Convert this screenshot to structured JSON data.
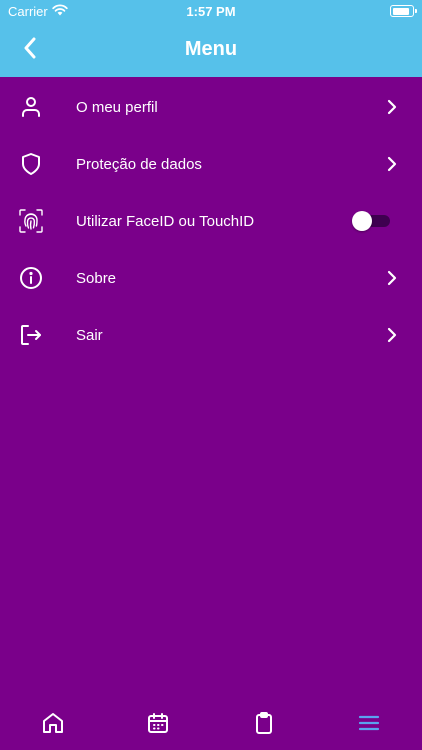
{
  "status_bar": {
    "carrier": "Carrier",
    "time": "1:57 PM"
  },
  "nav": {
    "title": "Menu",
    "back_icon": "chevron-left-icon"
  },
  "colors": {
    "header_bg": "#56c1ea",
    "page_bg": "#7a008a",
    "active_tab": "#5aa2f0",
    "text": "#ffffff"
  },
  "menu": {
    "items": [
      {
        "label": "O meu perfil",
        "icon": "user-icon",
        "control": "chevron"
      },
      {
        "label": "Proteção de dados",
        "icon": "shield-icon",
        "control": "chevron"
      },
      {
        "label": "Utilizar FaceID ou TouchID",
        "icon": "fingerprint-icon",
        "control": "toggle",
        "toggle_on": false
      },
      {
        "label": "Sobre",
        "icon": "info-icon",
        "control": "chevron"
      },
      {
        "label": "Sair",
        "icon": "logout-icon",
        "control": "chevron"
      }
    ]
  },
  "tab_bar": {
    "tabs": [
      {
        "icon": "home-icon",
        "active": false
      },
      {
        "icon": "calendar-icon",
        "active": false
      },
      {
        "icon": "clipboard-icon",
        "active": false
      },
      {
        "icon": "menu-icon",
        "active": true
      }
    ]
  }
}
